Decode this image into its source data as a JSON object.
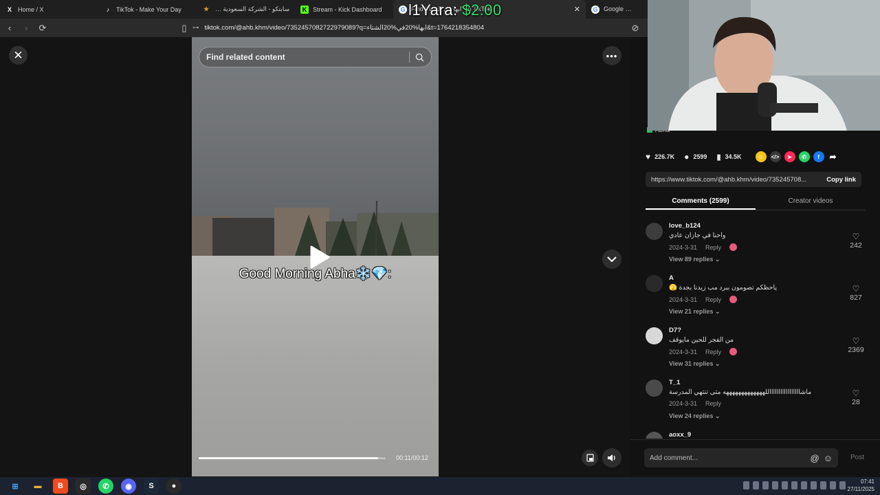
{
  "browser": {
    "tabs": [
      {
        "label": "Home / X",
        "icon": "x-logo-icon",
        "color": "#000000",
        "glyph": "X"
      },
      {
        "label": "TikTok - Make Your Day",
        "icon": "tiktok-icon",
        "color": "#111111",
        "glyph": "♪"
      },
      {
        "label": "سابتكو - الشركة السعودية للنقل",
        "icon": "star-icon",
        "color": "#d89b2b",
        "glyph": "★"
      },
      {
        "label": "Stream - Kick Dashboard",
        "icon": "kick-icon",
        "color": "#53fc18",
        "glyph": "K"
      },
      {
        "label": "Find 'ابها في الشتاء' on TikTok",
        "icon": "google-icon",
        "color": "#ffffff",
        "glyph": "G"
      },
      {
        "label": "Google بحث",
        "icon": "google-icon",
        "color": "#ffffff",
        "glyph": "G"
      }
    ],
    "url": "tiktok.com/@ahb.khm/video/7352457082722979089?q=ابها%20في%20الشتاء&t=1764218354804"
  },
  "overlay": {
    "donor": "l1Yara:",
    "amount": "$2.00"
  },
  "video": {
    "search_placeholder": "Find related content",
    "caption": "Good Morning Abha❄️💎:",
    "time": "00:11/00:12",
    "progress": 0.96
  },
  "panel": {
    "author_tag": "Abha",
    "stats": {
      "likes": "226.7K",
      "comments": "2599",
      "saves": "34.5K"
    },
    "share_colors": [
      "#f5c518",
      "#3a3a3a",
      "#fe2c55",
      "#25d366",
      "#1877f2",
      "#121212"
    ],
    "link": "https://www.tiktok.com/@ahb.khm/video/735245708...",
    "copy_label": "Copy link",
    "tabs": [
      "Comments (2599)",
      "Creator videos"
    ],
    "comments": [
      {
        "user": "love_b124",
        "text": "واحنا في جازان عادي",
        "date": "2024-3-31",
        "reply": "Reply",
        "replies": "View 89 replies ⌄",
        "likes": "242"
      },
      {
        "user": "A",
        "text": "ياحظكم تصومون ببرد مب زيدنا بجدة 🫣",
        "date": "2024-3-31",
        "reply": "Reply",
        "replies": "View 21 replies ⌄",
        "likes": "827"
      },
      {
        "user": "D7?",
        "text": "من الفجر للحين مايوقف",
        "date": "2024-3-31",
        "reply": "Reply",
        "replies": "View 31 replies ⌄",
        "likes": "2369"
      },
      {
        "user": "T_1",
        "text": "ماشاااااااااااااااااللهههههههههههههه متى تنتهي المدرسة",
        "date": "2024-3-31",
        "reply": "Reply",
        "replies": "View 24 replies ⌄",
        "likes": "28"
      },
      {
        "user": "aoxx_9",
        "text": "",
        "date": "",
        "reply": "",
        "replies": "",
        "likes": ""
      }
    ],
    "compose_placeholder": "Add comment...",
    "post_label": "Post"
  },
  "taskbar": {
    "time": "07:41",
    "date": "27/11/2025",
    "apps": [
      {
        "name": "windows-start-icon",
        "color": "#2b7bd3",
        "glyph": "⊞"
      },
      {
        "name": "file-explorer-icon",
        "color": "#e8b432",
        "glyph": "▬"
      },
      {
        "name": "brave-browser-icon",
        "color": "#f04a1f",
        "glyph": "B"
      },
      {
        "name": "gauge-app-icon",
        "color": "#2a2a2a",
        "glyph": "◎"
      },
      {
        "name": "whatsapp-icon",
        "color": "#25d366",
        "glyph": "✆"
      },
      {
        "name": "discord-icon",
        "color": "#5865f2",
        "glyph": "◉"
      },
      {
        "name": "steam-icon",
        "color": "#1b2838",
        "glyph": "S"
      },
      {
        "name": "obs-icon",
        "color": "#2a2a2a",
        "glyph": "●"
      }
    ]
  }
}
